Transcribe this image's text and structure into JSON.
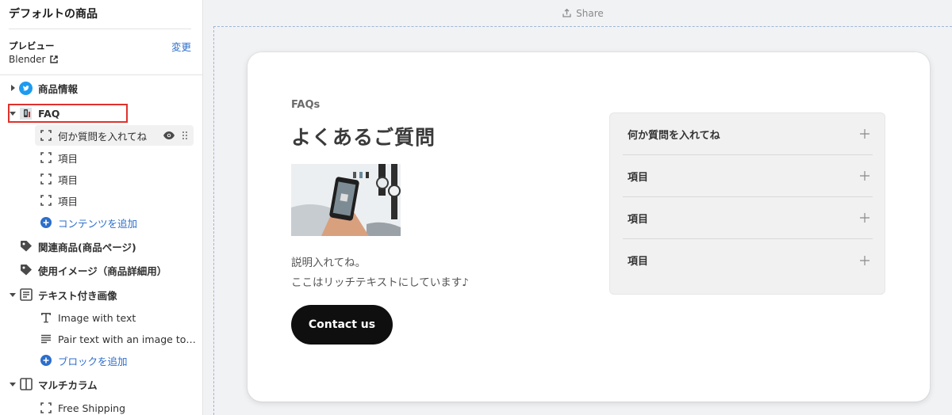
{
  "sidebar": {
    "title": "デフォルトの商品",
    "preview_label": "プレビュー",
    "preview_value": "Blender",
    "change_link": "変更",
    "sections": [
      {
        "label": "商品情報",
        "icon": "twitter-bird-icon"
      },
      {
        "label": "FAQ",
        "icon": "faq-thumbnail-icon"
      },
      {
        "label": "関連商品(商品ページ)",
        "icon": "tag-icon"
      },
      {
        "label": "使用イメージ（商品詳細用）",
        "icon": "tag-icon"
      },
      {
        "label": "テキスト付き画像",
        "icon": "text-block-icon"
      },
      {
        "label": "マルチカラム",
        "icon": "columns-icon"
      }
    ],
    "faq_blocks": [
      "何か質問を入れてね",
      "項目",
      "項目",
      "項目"
    ],
    "faq_add": "コンテンツを追加",
    "image_text_blocks": [
      "Image with text",
      "Pair text with an image to focus on your chosen product, collection, or blog post."
    ],
    "image_text_add": "ブロックを追加",
    "multicolumn_blocks": [
      "Free Shipping"
    ]
  },
  "topbar": {
    "share_label": "Share"
  },
  "faq_section": {
    "kicker": "FAQs",
    "heading": "よくあるご質問",
    "description_line1": "説明入れてね。",
    "description_line2": "ここはリッチテキストにしています♪",
    "button_label": "Contact us",
    "items": [
      "何か質問を入れてね",
      "項目",
      "項目",
      "項目"
    ]
  },
  "colors": {
    "accent_link": "#2c6ecb",
    "highlight_box": "#e0322c",
    "button_bg": "#0f0f0f"
  }
}
